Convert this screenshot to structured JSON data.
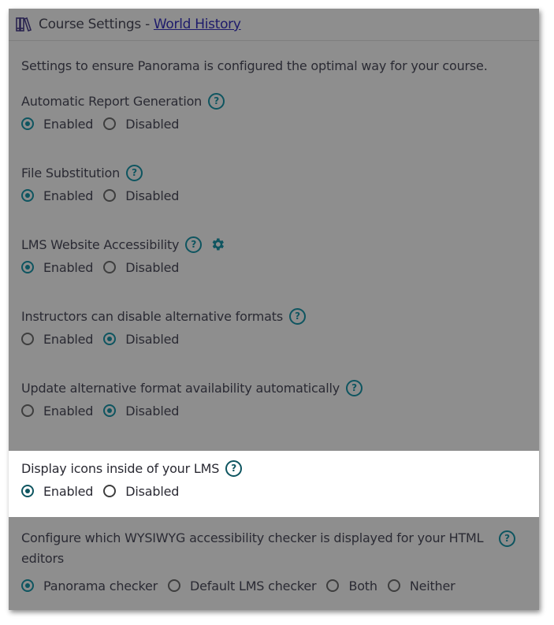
{
  "header": {
    "title_prefix": "Course Settings -",
    "course_link": "World History",
    "icon": "books-icon"
  },
  "intro": "Settings to ensure Panorama is configured the optimal way for your course.",
  "settings": [
    {
      "title": "Automatic Report Generation",
      "has_gear": false,
      "options": [
        "Enabled",
        "Disabled"
      ],
      "selected": "Enabled"
    },
    {
      "title": "File Substitution",
      "has_gear": false,
      "options": [
        "Enabled",
        "Disabled"
      ],
      "selected": "Enabled"
    },
    {
      "title": "LMS Website Accessibility",
      "has_gear": true,
      "options": [
        "Enabled",
        "Disabled"
      ],
      "selected": "Enabled"
    },
    {
      "title": "Instructors can disable alternative formats",
      "has_gear": false,
      "options": [
        "Enabled",
        "Disabled"
      ],
      "selected": "Disabled"
    },
    {
      "title": "Update alternative format availability automatically",
      "has_gear": false,
      "options": [
        "Enabled",
        "Disabled"
      ],
      "selected": "Disabled"
    }
  ],
  "highlighted_setting": {
    "title": "Display icons inside of your LMS",
    "options": [
      "Enabled",
      "Disabled"
    ],
    "selected": "Enabled"
  },
  "wysiwyg_setting": {
    "title": "Configure which WYSIWYG accessibility checker is displayed for your HTML editors",
    "options": [
      "Panorama checker",
      "Default LMS checker",
      "Both",
      "Neither"
    ],
    "selected": "Panorama checker"
  },
  "colors": {
    "accent": "#0e5560",
    "overlay": "#8e8e8e",
    "link": "#1d1a6b"
  }
}
